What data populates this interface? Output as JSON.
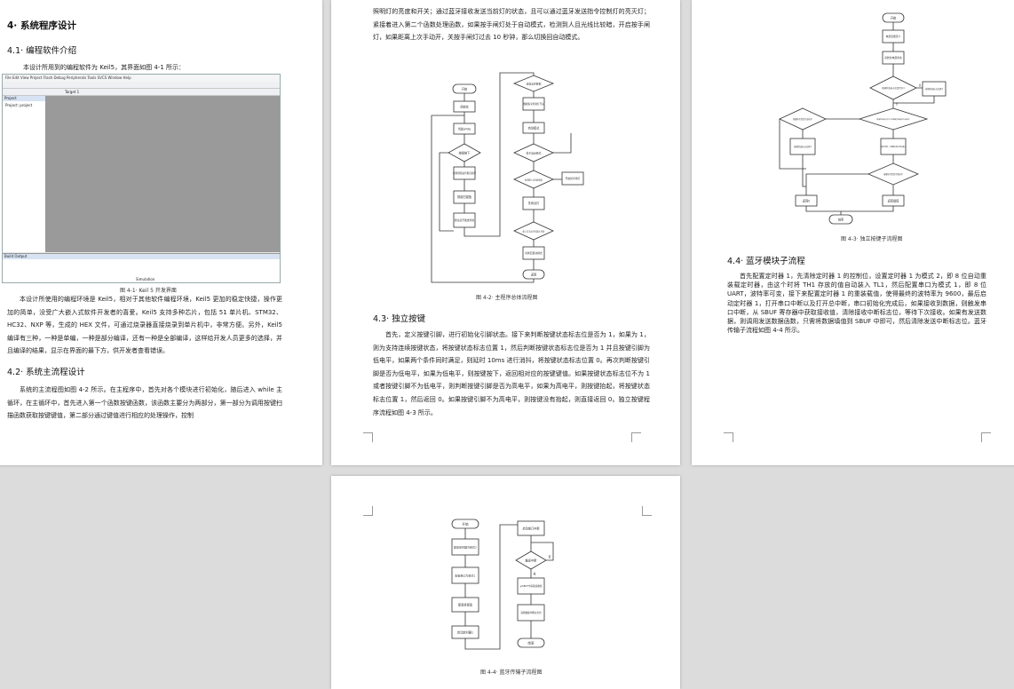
{
  "page1": {
    "h_ch4": "4· 系统程序设计",
    "h_41": "4.1· 编程软件介绍",
    "p_41_intro": "本设计所用到的编程软件为 Keil5，其界面如图 4-1 所示：",
    "keil": {
      "menu": "File  Edit  View  Project  Flash  Debug  Peripherals  Tools  SVCS  Window  Help",
      "target": "Target 1",
      "panel_title": "Project",
      "project_item": "Project: project",
      "output_title": "Build Output",
      "status": "Simulation"
    },
    "fig41_caption": "图 4-1· Keil 5 开发界面",
    "p_41_body": "本设计所使用的编程环境是 Keil5，相对于其他软件编程环境，Keil5 更加的稳定快捷，操作更加的简单，没受广大嵌入式软件开发者的喜爱。Keil5 支持多种芯片，包括 51 单片机、STM32、HC32、NXP 等，生成的 HEX 文件，可通过烧录器直接烧录到单片机中，非常方便。另外，Keil5 编译有三种，一种是单编，一种是部分编译，还有一种是全部编译，这样给开发人员更多的选择，并且编译的结果，显示在界面的最下方，供开发者查看错误。",
    "h_42": "4.2· 系统主流程设计",
    "p_42_body": "系统的主流程图如图 4-2 所示。在主程序中，首先对各个模块进行初始化，随后进入 while 主循环，在主循环中，首先进入第一个函数按键函数，该函数主要分为两部分，第一部分为调用按键扫描函数获取按键键值，第二部分通过键值进行相应的处理操作，控制"
  },
  "page2": {
    "p_top": "照明灯的亮度和开关；通过蓝牙接收发送当前灯的状态，且可以通过蓝牙发送指令控制灯的亮灭灯；紧接着进入第二个函数处理函数，如果按手闸灯处于自动模式，检测到人且光线比较暗，开启按手闸灯，如果距离上次手动开，关按手闸灯过去 10 秒钟，那么切换回自动模式。",
    "flow": {
      "start": "开始",
      "init": "初始化",
      "loop": "当前while",
      "key_diamond": "按键按下",
      "key_proc": "按键键值进行相应处理",
      "key_scan": "按键扫描值",
      "bt_send": "通过蓝牙发送状态",
      "d_bt": "接收蓝牙数据",
      "p_bt": "根据指令控制灯开关",
      "auto_mode": "自动模式",
      "d_auto": "处于自动模式",
      "d_person": "检测到人且光线较暗",
      "p_open": "开启按手闸灯",
      "p_close": "关闭台灯",
      "d_timeout": "距上次手动开关超过10秒",
      "p_switch": "切换回自动模式",
      "end": "返回"
    },
    "fig42_caption": "图 4-2· 主程序总体流程图",
    "h_43": "4.3· 独立按键",
    "p_43_body": "首先，定义按键引脚，进行初始化引脚状态。接下来判断按键状态标志位是否为 1，如果为 1，则为支持连续按键状态，将按键状态标志位置 1，然后判断按键状态标志位是否为 1 并且按键引脚为低电平，如果两个条件同时满足，则延时 10ms 进行消抖，将按键状态标志位置 0。再次判断按键引脚是否为低电平，如果为低电平，则按键按下，返回相对应的按键键值。如果按键状态标志位不为 1 或者按键引脚不为低电平，则判断按键引脚是否为高电平，如果为高电平，则按键抬起，将按键状态标志位置 1，然后返回 0。如果按键引脚不为高电平，则按键没有抬起，则直接返回 0。独立按键程序流程如图 4-3 所示。"
  },
  "page3": {
    "flow": {
      "start": "开始",
      "define": "电源变量定义",
      "init": "初始化电源状态",
      "d_flag": "按键状态标志位是否为1",
      "p_flag": "按键状态标志位置1",
      "d_both": "按键状态标志位为1且按键引脚是否为低电平",
      "d_high": "按键电平是否为高电平",
      "p_flag1": "按键状态标志位置1",
      "p_delay": "延时消抖，按键状态标志位置0",
      "d_low": "按键电平是否为低电平",
      "p_ret0": "返回0",
      "p_retkey": "返回键值",
      "end": "结束",
      "yes": "是",
      "no": "否"
    },
    "fig43_caption": "图 4-3· 独立按键子流程图",
    "h_44": "4.4· 蓝牙模块子流程",
    "p_44_body": "首先配置定时器 1，先清除定时器 1 的控制位，设置定时器 1 为模式 2，即 8 位自动重装载定时器，由这个时将 TH1 存放的值自动装入 TL1，然后配置串口为模式 1，即 8 位 UART，波特率可变，接下来配置定时器 1 的重装载值，使得最终的波特率为 9600，最后启动定时器 1，打开串口中断以及打开总中断，串口初始化完成后，如果接收到数据，则触发串口中断，从 SBUF 寄存器中获取接收值，清除接收中断标志位，等待下次接收。如果有发送数据，则调用发送数据函数，只需将数据填值到 SBUF 中即可，然后清除发送中断标志位。蓝牙传输子流程如图 4-4 所示。"
  },
  "page4": {
    "flow": {
      "start": "开始",
      "p1": "配置定时器为模式2",
      "p2": "配置串口为模式1",
      "p3": "配置重置值",
      "p4": "启动定时器1",
      "q1": "启动串口中断",
      "d1": "触发中断",
      "q2": "从SBUF中获取接收值",
      "q3": "清除数据中断标志位",
      "end": "结束",
      "yes": "是",
      "no": "否"
    },
    "fig44_caption": "图 4-4· 蓝牙传输子流程图"
  }
}
